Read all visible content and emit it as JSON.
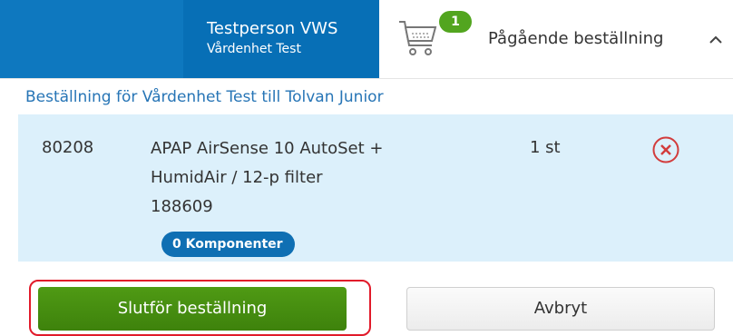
{
  "header": {
    "user_name": "Testperson VWS",
    "user_unit": "Vårdenhet Test",
    "cart_count": "1",
    "order_status": "Pågående beställning",
    "icons": {
      "cart": "shopping-cart-icon",
      "expand": "chevron-up-icon"
    },
    "colors": {
      "header_blue": "#0e78bf",
      "badge_green": "#52a51f"
    }
  },
  "order": {
    "title": "Beställning för Vårdenhet Test till Tolvan Junior",
    "items": [
      {
        "article_number": "80208",
        "name_line1": "APAP AirSense 10 AutoSet +",
        "name_line2": "HumidAir / 12-p filter",
        "code": "188609",
        "quantity": "1 st",
        "components": "0 Komponenter",
        "remove_icon": "remove-circle-icon"
      }
    ]
  },
  "actions": {
    "primary": "Slutför beställning",
    "secondary": "Avbryt",
    "colors": {
      "primary": "#4a9412",
      "focus_ring": "#e11a2a"
    }
  }
}
